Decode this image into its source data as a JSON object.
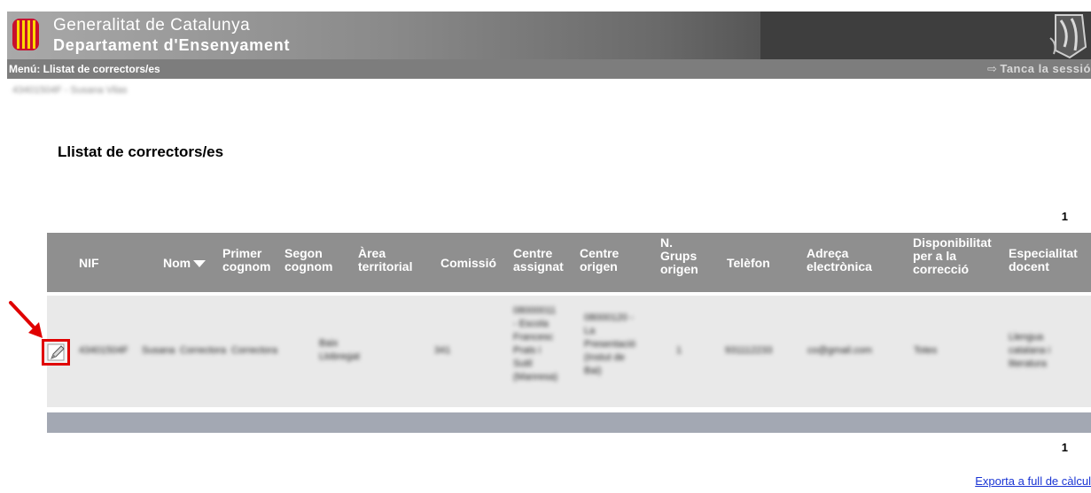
{
  "header": {
    "org": "Generalitat de Catalunya",
    "department": "Departament d'Ensenyament"
  },
  "menubar": {
    "prefix": "Menú:",
    "current": "Llistat de correctors/es",
    "logout": "Tanca la sessió"
  },
  "user": {
    "identity": "43401504F - Susana Vilas"
  },
  "page": {
    "title": "Llistat de correctors/es"
  },
  "pager": {
    "top": "1",
    "bottom": "1"
  },
  "table": {
    "headers": {
      "nif": "NIF",
      "nom": "Nom",
      "primer": [
        "Primer",
        "cognom"
      ],
      "segon": [
        "Segon",
        "cognom"
      ],
      "area": [
        "Àrea",
        "territorial"
      ],
      "comissio": "Comissió",
      "centre_assignat": [
        "Centre",
        "assignat"
      ],
      "centre_origen": [
        "Centre",
        "origen"
      ],
      "grups": [
        "N.",
        "Grups",
        "origen"
      ],
      "telefon": "Telèfon",
      "adreca": [
        "Adreça",
        "electrònica"
      ],
      "disponibilitat": [
        "Disponibilitat",
        "per a la",
        "correcció"
      ],
      "especialitat": [
        "Especialitat",
        "docent"
      ]
    },
    "row": {
      "nif": "43401504F",
      "nom": "Susana",
      "primer": "Correctora",
      "segon": "Correctora",
      "area": [
        "Baix",
        "Llobregat"
      ],
      "comissio": "341",
      "centre_assignat": [
        "08000011",
        "- Escola",
        "Francesc",
        "Prats i",
        "Sutil",
        "(Manresa)"
      ],
      "centre_origen": [
        "08000120 -",
        "La",
        "Presentació",
        "(Instut de",
        "Bai)"
      ],
      "grups": "1",
      "telefon": "931112233",
      "adreca": "co@gmail.com",
      "disponibilitat": "Totes",
      "especialitat": [
        "Llengua",
        "catalana i",
        "literatura"
      ]
    }
  },
  "export": {
    "label": "Exporta a full de càlcul"
  },
  "colors": {
    "header_dark": "#3e3e3e",
    "table_head": "#8f8f8f",
    "row_bg": "#e9e9e9",
    "highlight": "#e00000",
    "link": "#1a35d4"
  }
}
